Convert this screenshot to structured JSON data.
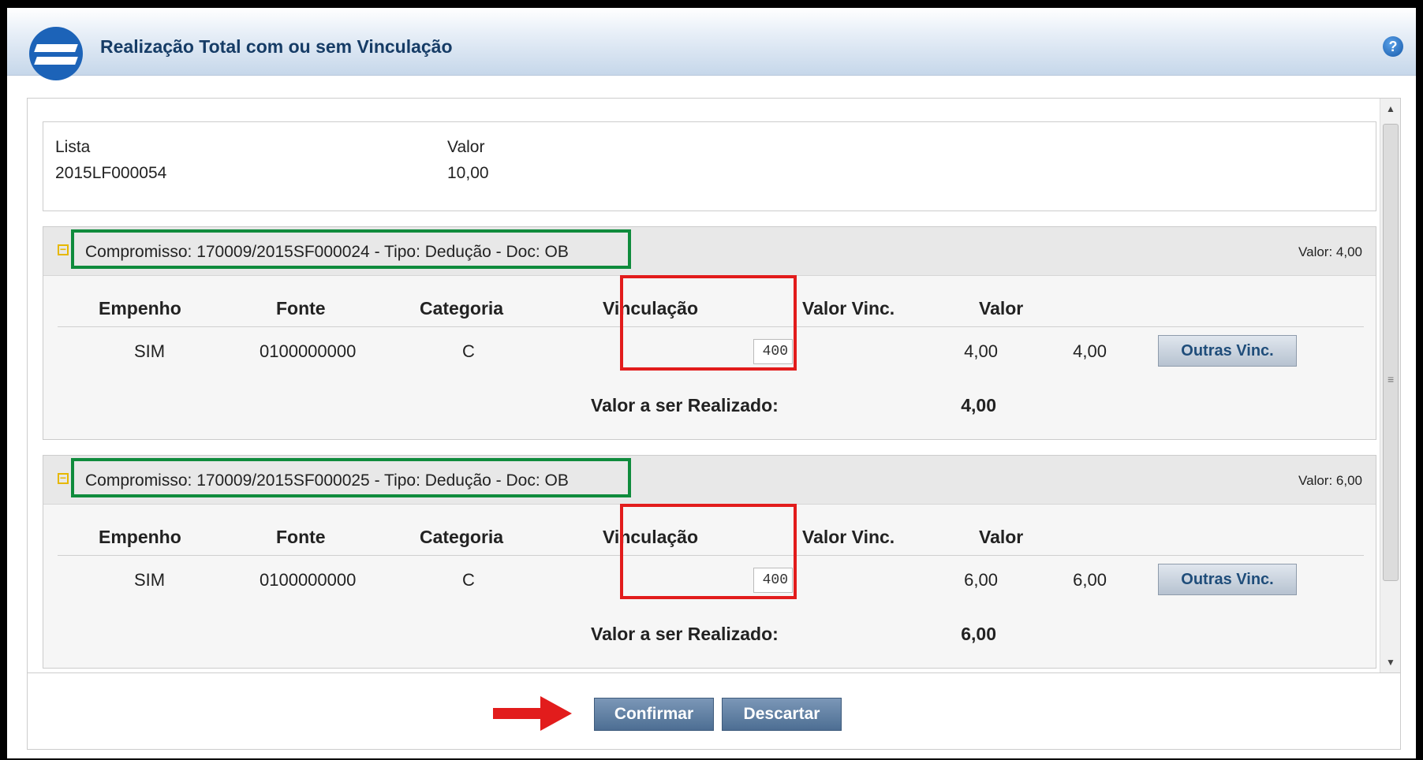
{
  "window": {
    "title": "Realização Total com ou sem Vinculação"
  },
  "info": {
    "lista_label": "Lista",
    "lista_value": "2015LF000054",
    "valor_label": "Valor",
    "valor_value": "10,00"
  },
  "table_headers": {
    "empenho": "Empenho",
    "fonte": "Fonte",
    "categoria": "Categoria",
    "vinculacao": "Vinculação",
    "valor_vinc": "Valor Vinc.",
    "valor": "Valor"
  },
  "panels": [
    {
      "title": "Compromisso: 170009/2015SF000024 - Tipo: Dedução - Doc: OB",
      "valor": "Valor: 4,00",
      "row": {
        "empenho": "SIM",
        "fonte": "0100000000",
        "categoria": "C",
        "vinculacao": "400",
        "valor_vinc": "4,00",
        "valor": "4,00",
        "button": "Outras Vinc."
      },
      "sum_label": "Valor a ser Realizado:",
      "sum_value": "4,00"
    },
    {
      "title": "Compromisso: 170009/2015SF000025 - Tipo: Dedução - Doc: OB",
      "valor": "Valor: 6,00",
      "row": {
        "empenho": "SIM",
        "fonte": "0100000000",
        "categoria": "C",
        "vinculacao": "400",
        "valor_vinc": "6,00",
        "valor": "6,00",
        "button": "Outras Vinc."
      },
      "sum_label": "Valor a ser Realizado:",
      "sum_value": "6,00"
    }
  ],
  "footer": {
    "confirm_label": "Confirmar",
    "discard_label": "Descartar"
  },
  "help_icon": "?",
  "colors": {
    "annotation_green": "#0f8b3c",
    "annotation_red": "#e21c1c",
    "title_text": "#163c66",
    "button_blue": "#4d6e93"
  }
}
